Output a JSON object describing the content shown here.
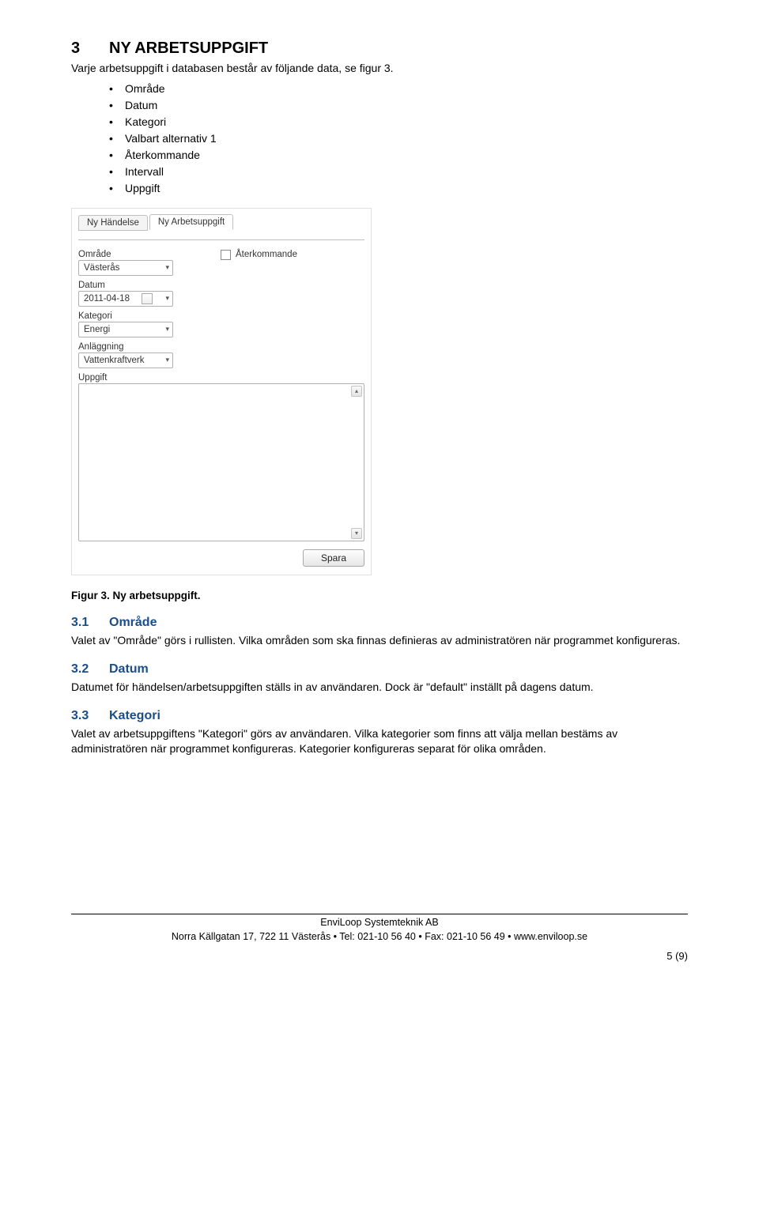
{
  "heading": {
    "num": "3",
    "title": "NY ARBETSUPPGIFT"
  },
  "intro": "Varje arbetsuppgift i databasen består av följande data, se figur 3.",
  "bullets": [
    "Område",
    "Datum",
    "Kategori",
    "Valbart alternativ 1",
    "Återkommande",
    "Intervall",
    "Uppgift"
  ],
  "app": {
    "tab_inactive": "Ny Händelse",
    "tab_active": "Ny Arbetsuppgift",
    "labels": {
      "omrade": "Område",
      "datum": "Datum",
      "kategori": "Kategori",
      "anlaggning": "Anläggning",
      "uppgift": "Uppgift",
      "aterkommande": "Återkommande"
    },
    "values": {
      "omrade": "Västerås",
      "datum": "2011-04-18",
      "kategori": "Energi",
      "anlaggning": "Vattenkraftverk"
    },
    "save": "Spara"
  },
  "caption": "Figur 3. Ny arbetsuppgift.",
  "sections": [
    {
      "num": "3.1",
      "title": "Område",
      "text": "Valet av \"Område\" görs i rullisten. Vilka områden som ska finnas definieras av administratören när programmet konfigureras."
    },
    {
      "num": "3.2",
      "title": "Datum",
      "text": "Datumet för händelsen/arbetsuppgiften ställs in av användaren. Dock är \"default\" inställt på dagens datum."
    },
    {
      "num": "3.3",
      "title": "Kategori",
      "text": "Valet av arbetsuppgiftens \"Kategori\" görs av användaren. Vilka kategorier som finns att välja mellan bestäms av administratören när programmet konfigureras. Kategorier konfigureras separat för olika områden."
    }
  ],
  "footer": {
    "company": "EnviLoop Systemteknik AB",
    "address": "Norra Källgatan 17, 722 11 Västerås • Tel: 021-10 56 40 • Fax: 021-10 56 49 • www.enviloop.se"
  },
  "page": "5 (9)"
}
